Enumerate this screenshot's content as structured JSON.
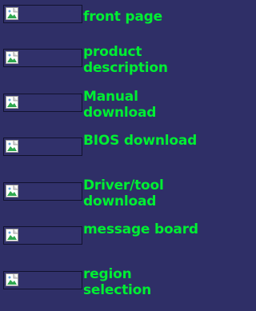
{
  "nav": {
    "items": [
      {
        "label": "front page",
        "icon": "broken-image-icon"
      },
      {
        "label": "product description",
        "icon": "broken-image-icon"
      },
      {
        "label": "Manual download",
        "icon": "broken-image-icon"
      },
      {
        "label": "BIOS download",
        "icon": "broken-image-icon"
      },
      {
        "label": "Driver/tool download",
        "icon": "broken-image-icon"
      },
      {
        "label": "message board",
        "icon": "broken-image-icon"
      },
      {
        "label": "region selection",
        "icon": "broken-image-icon"
      }
    ]
  },
  "colors": {
    "background": "#2f2f67",
    "label": "#00ee33",
    "thumb_background": "#31316b"
  }
}
